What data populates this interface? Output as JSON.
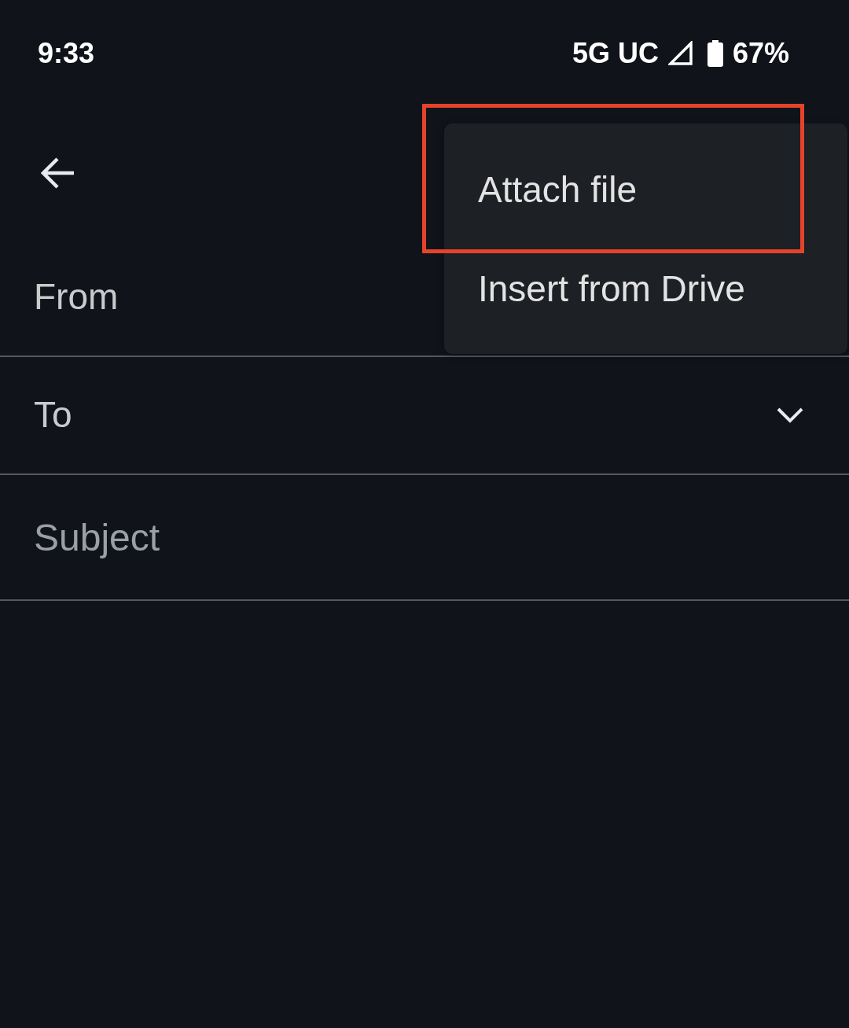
{
  "status_bar": {
    "time": "9:33",
    "network": "5G UC",
    "battery": "67%"
  },
  "fields": [
    {
      "kind": "sender",
      "label": "From"
    },
    {
      "kind": "recipients",
      "label": "To"
    },
    {
      "kind": "subject",
      "placeholder": "Subject"
    }
  ],
  "menu": {
    "items": [
      {
        "label": "Attach file",
        "highlighted": true
      },
      {
        "label": "Insert from Drive",
        "highlighted": false
      }
    ]
  }
}
